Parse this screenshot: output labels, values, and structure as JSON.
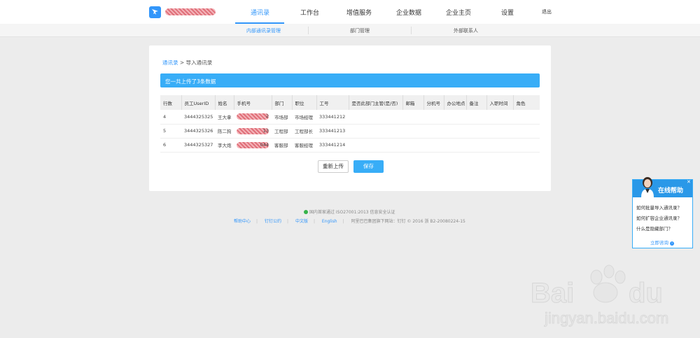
{
  "nav": {
    "items": [
      {
        "label": "通讯录",
        "active": true
      },
      {
        "label": "工作台"
      },
      {
        "label": "增值服务"
      },
      {
        "label": "企业数据"
      },
      {
        "label": "企业主页"
      },
      {
        "label": "设置"
      }
    ],
    "logout": "退出"
  },
  "subnav": {
    "items": [
      {
        "label": "内部通讯录管理",
        "active": true
      },
      {
        "label": "部门管理"
      },
      {
        "label": "外部联系人"
      }
    ]
  },
  "breadcrumb": {
    "root": "通讯录",
    "current": "导入通讯录"
  },
  "banner": "您一共上传了3条数据",
  "table": {
    "headers": [
      "行数",
      "员工UserID",
      "姓名",
      "手机号",
      "部门",
      "职位",
      "工号",
      "是否此部门主管(是/否)",
      "邮箱",
      "分机号",
      "办公地点",
      "备注",
      "入职时间",
      "角色"
    ],
    "rows": [
      {
        "row": "4",
        "userid": "3444325325",
        "name": "王大拿",
        "phone_tail": "2",
        "dept": "市场部",
        "title": "市场经理",
        "empno": "333441212"
      },
      {
        "row": "5",
        "userid": "3444325326",
        "name": "陈二狗",
        "phone_tail": "13",
        "dept": "工程部",
        "title": "工程部长",
        "empno": "333441213"
      },
      {
        "row": "6",
        "userid": "3444325327",
        "name": "李大炮",
        "phone_tail": "044",
        "dept": "客服部",
        "title": "客服经理",
        "empno": "333441214"
      }
    ]
  },
  "buttons": {
    "reupload": "重新上传",
    "save": "保存"
  },
  "footer": {
    "cert": "国内首家通过 ISO27001:2013 信息安全认证",
    "links": [
      "帮助中心",
      "钉钉公约",
      "中文版",
      "English"
    ],
    "copyright": "阿里巴巴集团旗下网站：钉钉 © 2016 浙 B2-20080224-15"
  },
  "help": {
    "title": "在线帮助",
    "questions": [
      "如何批量导入通讯录？",
      "如何扩容企业通讯录？",
      "什么是隐藏部门？"
    ],
    "more": "立即咨询"
  },
  "colors": {
    "accent": "#3296fa",
    "banner": "#38adf7"
  }
}
